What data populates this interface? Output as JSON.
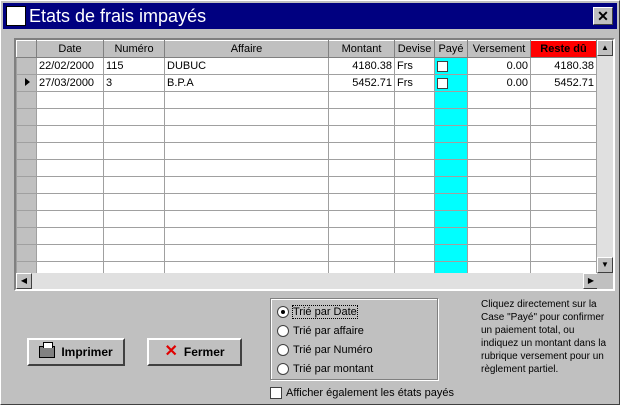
{
  "window": {
    "title": "Etats de frais impayés",
    "close_glyph": "✕"
  },
  "grid": {
    "columns": [
      "Date",
      "Numéro",
      "Affaire",
      "Montant",
      "Devise",
      "Payé",
      "Versement",
      "Reste dû"
    ],
    "rows": [
      {
        "date": "22/02/2000",
        "numero": "115",
        "affaire": "DUBUC",
        "montant": "4180.38",
        "devise": "Frs",
        "paye": false,
        "versement": "0.00",
        "reste": "4180.38",
        "current": false
      },
      {
        "date": "27/03/2000",
        "numero": "3",
        "affaire": "B.P.A",
        "montant": "5452.71",
        "devise": "Frs",
        "paye": false,
        "versement": "0.00",
        "reste": "5452.71",
        "current": true
      }
    ],
    "empty_rows": 11,
    "accent_colors": {
      "paye_column": "#00ffff",
      "reste_header": "#ff0000"
    }
  },
  "buttons": {
    "print": "Imprimer",
    "close": "Fermer"
  },
  "sort": {
    "options": [
      "Trié par Date",
      "Trié par affaire",
      "Trié par Numéro",
      "Trié par montant"
    ],
    "selected": 0
  },
  "show_paid": {
    "label": "Afficher également les états payés",
    "checked": false
  },
  "help_text": "Cliquez directement sur la Case \"Payé\" pour confirmer un paiement total, ou indiquez un montant dans la rubrique versement pour un règlement partiel."
}
